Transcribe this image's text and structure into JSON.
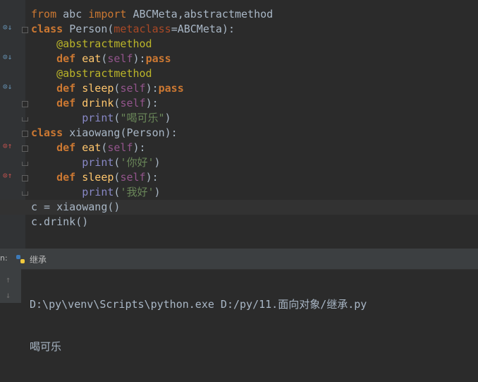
{
  "editor": {
    "lines": [
      [
        {
          "t": "from ",
          "c": "kw2"
        },
        {
          "t": "abc ",
          "c": "cls"
        },
        {
          "t": "import ",
          "c": "kw2"
        },
        {
          "t": "ABCMeta,abstractmethod",
          "c": "cls"
        }
      ],
      [
        {
          "t": "class ",
          "c": "kw"
        },
        {
          "t": "Person",
          "c": "cls"
        },
        {
          "t": "(",
          "c": "cls"
        },
        {
          "t": "metaclass",
          "c": "param"
        },
        {
          "t": "=ABCMeta):",
          "c": "cls"
        }
      ],
      [
        {
          "t": "    ",
          "c": "cls"
        },
        {
          "t": "@abstractmethod",
          "c": "deco"
        }
      ],
      [
        {
          "t": "    ",
          "c": "cls"
        },
        {
          "t": "def ",
          "c": "kw"
        },
        {
          "t": "eat",
          "c": "fn"
        },
        {
          "t": "(",
          "c": "cls"
        },
        {
          "t": "self",
          "c": "self"
        },
        {
          "t": "):",
          "c": "cls"
        },
        {
          "t": "pass",
          "c": "kw"
        }
      ],
      [
        {
          "t": "    ",
          "c": "cls"
        },
        {
          "t": "@abstractmethod",
          "c": "deco"
        }
      ],
      [
        {
          "t": "    ",
          "c": "cls"
        },
        {
          "t": "def ",
          "c": "kw"
        },
        {
          "t": "sleep",
          "c": "fn"
        },
        {
          "t": "(",
          "c": "cls"
        },
        {
          "t": "self",
          "c": "self"
        },
        {
          "t": "):",
          "c": "cls"
        },
        {
          "t": "pass",
          "c": "kw"
        }
      ],
      [
        {
          "t": "    ",
          "c": "cls"
        },
        {
          "t": "def ",
          "c": "kw"
        },
        {
          "t": "drink",
          "c": "fn"
        },
        {
          "t": "(",
          "c": "cls"
        },
        {
          "t": "self",
          "c": "self"
        },
        {
          "t": "):",
          "c": "cls"
        }
      ],
      [
        {
          "t": "        ",
          "c": "cls"
        },
        {
          "t": "print",
          "c": "builtin"
        },
        {
          "t": "(",
          "c": "cls"
        },
        {
          "t": "\"喝可乐\"",
          "c": "str"
        },
        {
          "t": ")",
          "c": "cls"
        }
      ],
      [
        {
          "t": "class ",
          "c": "kw"
        },
        {
          "t": "xiaowang",
          "c": "cls"
        },
        {
          "t": "(",
          "c": "cls"
        },
        {
          "t": "Person",
          "c": "cls"
        },
        {
          "t": "):",
          "c": "cls"
        }
      ],
      [
        {
          "t": "    ",
          "c": "cls"
        },
        {
          "t": "def ",
          "c": "kw"
        },
        {
          "t": "eat",
          "c": "fn"
        },
        {
          "t": "(",
          "c": "cls"
        },
        {
          "t": "self",
          "c": "self"
        },
        {
          "t": "):",
          "c": "cls"
        }
      ],
      [
        {
          "t": "        ",
          "c": "cls"
        },
        {
          "t": "print",
          "c": "builtin"
        },
        {
          "t": "(",
          "c": "cls"
        },
        {
          "t": "'你好'",
          "c": "str"
        },
        {
          "t": ")",
          "c": "cls"
        }
      ],
      [
        {
          "t": "    ",
          "c": "cls"
        },
        {
          "t": "def ",
          "c": "kw"
        },
        {
          "t": "sleep",
          "c": "fn"
        },
        {
          "t": "(",
          "c": "cls"
        },
        {
          "t": "self",
          "c": "self"
        },
        {
          "t": "):",
          "c": "cls"
        }
      ],
      [
        {
          "t": "        ",
          "c": "cls"
        },
        {
          "t": "print",
          "c": "builtin"
        },
        {
          "t": "(",
          "c": "cls"
        },
        {
          "t": "'我好'",
          "c": "str"
        },
        {
          "t": ")",
          "c": "cls"
        }
      ],
      [
        {
          "t": "c = xiaowang()",
          "c": "cls"
        }
      ],
      [
        {
          "t": "c.drink()",
          "c": "cls"
        }
      ]
    ]
  },
  "run": {
    "left_label": "n:",
    "tab_label": "继承",
    "output_line_1": "D:\\py\\venv\\Scripts\\python.exe D:/py/11.面向对象/继承.py",
    "output_line_2": "喝可乐"
  }
}
